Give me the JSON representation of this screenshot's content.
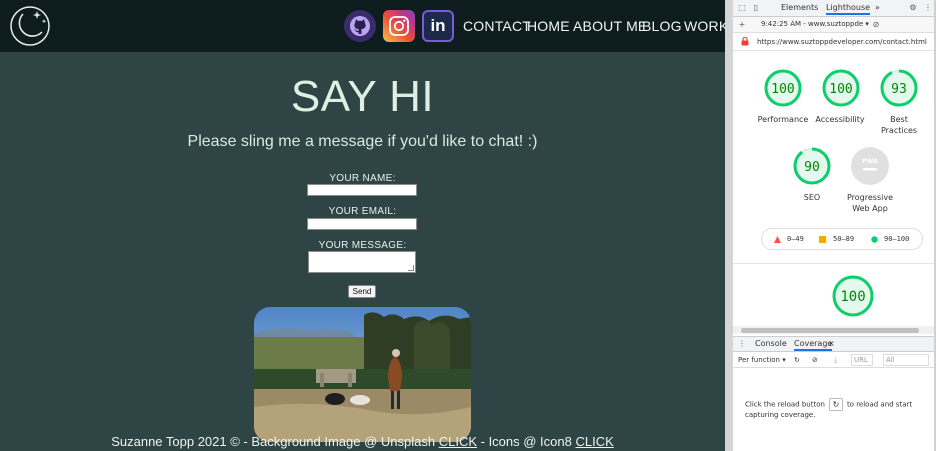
{
  "site": {
    "nav": {
      "contact": "CONTACT",
      "home": "HOME",
      "about": "ABOUT ME",
      "blog": "BLOG",
      "work": "WORK"
    },
    "social_icons": [
      "github-icon",
      "instagram-icon",
      "linkedin-icon"
    ],
    "linkedin_glyph": "in",
    "title": "SAY HI",
    "subtitle": "Please sling me a message if you'd like to chat! :)",
    "form": {
      "name_label": "YOUR NAME:",
      "email_label": "YOUR EMAIL:",
      "message_label": "YOUR MESSAGE:",
      "send_label": "Send"
    },
    "footer": {
      "text_prefix": "Suzanne Topp 2021 © - Background Image @ Unsplash ",
      "link1": "CLICK",
      "text_mid": " - Icons @ Icon8 ",
      "link2": "CLICK"
    },
    "colors": {
      "background": "#2f4545",
      "header": "#0d1d1d",
      "title": "#dff0e2"
    }
  },
  "devtools": {
    "tabs": {
      "elements": "Elements",
      "lighthouse": "Lighthouse",
      "more": "»"
    },
    "run": "9:42:25 AM - www.suztoppde ▾",
    "url": "https://www.suztoppdeveloper.com/contact.html",
    "scores": [
      {
        "label": "Performance",
        "value": "100",
        "score": 100
      },
      {
        "label": "Accessibility",
        "value": "100",
        "score": 100
      },
      {
        "label": "Best Practices",
        "value": "93",
        "score": 93
      },
      {
        "label": "SEO",
        "value": "90",
        "score": 90
      },
      {
        "label": "Progressive Web App",
        "value": "PWA",
        "score": null
      }
    ],
    "best_line1": "Best",
    "best_line2": "Practices",
    "pwa_line1": "Progressive",
    "pwa_line2": "Web App",
    "legend": {
      "low": "0–49",
      "mid": "50–89",
      "high": "90–100"
    },
    "big_score": "100",
    "drawer": {
      "console": "Console",
      "coverage": "Coverage",
      "close": "×",
      "per_function": "Per function ▾",
      "url_filter": "URL",
      "all": "All",
      "message_before": "Click the reload button",
      "message_after": "to reload and start capturing coverage."
    },
    "colors": {
      "pass": "#0cce6b",
      "pass_text": "#008800",
      "average": "#ffa400",
      "fail": "#ff4e42",
      "na": "#9e9e9e",
      "accent": "#1a73e8"
    }
  }
}
